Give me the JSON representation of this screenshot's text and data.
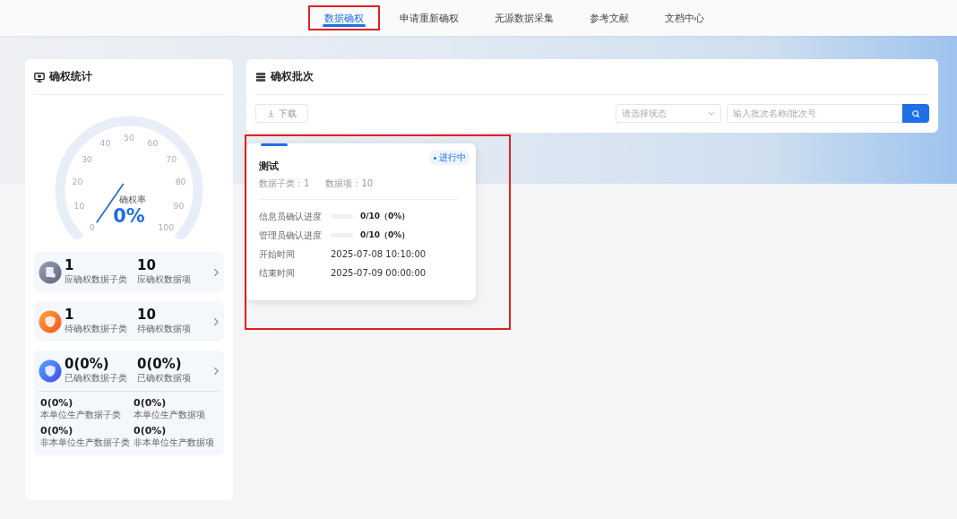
{
  "nav": {
    "tabs": [
      {
        "label": "数据确权",
        "selected": true,
        "highlight": true
      },
      {
        "label": "申请重新确权",
        "selected": false,
        "highlight": false
      },
      {
        "label": "无源数据采集",
        "selected": false,
        "highlight": false
      },
      {
        "label": "参考文献",
        "selected": false,
        "highlight": false
      },
      {
        "label": "文档中心",
        "selected": false,
        "highlight": false
      }
    ]
  },
  "stats": {
    "title": "确权统计",
    "gauge": {
      "ticks": [
        "0",
        "10",
        "20",
        "30",
        "40",
        "50",
        "60",
        "70",
        "80",
        "90",
        "100"
      ],
      "label": "确权率",
      "value": "0%"
    },
    "groups": [
      {
        "kind": "total",
        "a_value": "1",
        "a_label": "应确权数据子类",
        "b_value": "10",
        "b_label": "应确权数据项"
      },
      {
        "kind": "pending",
        "a_value": "1",
        "a_label": "待确权数据子类",
        "b_value": "10",
        "b_label": "待确权数据项"
      },
      {
        "kind": "done",
        "a_value": "0(0%)",
        "a_label": "已确权数据子类",
        "b_value": "0(0%)",
        "b_label": "已确权数据项",
        "details": [
          {
            "value": "0(0%)",
            "label": "本单位生产数据子类"
          },
          {
            "value": "0(0%)",
            "label": "本单位生产数据项"
          },
          {
            "value": "0(0%)",
            "label": "非本单位生产数据子类"
          },
          {
            "value": "0(0%)",
            "label": "非本单位生产数据项"
          }
        ]
      }
    ]
  },
  "batches": {
    "title": "确权批次",
    "download": "下载",
    "status_placeholder": "请选择状态",
    "search_placeholder": "输入批次名称/批次号",
    "cards": [
      {
        "name": "测试",
        "status": "进行中",
        "highlight": true,
        "subclass": "数据子类：1",
        "items": "数据项：10",
        "progress": [
          {
            "label": "信息员确认进度",
            "level": 0,
            "text": "0/10（0%）"
          },
          {
            "label": "管理员确认进度",
            "level": 0,
            "text": "0/10（0%）"
          }
        ],
        "times": [
          {
            "label": "开始时间",
            "value": "2025-07-08 10:10:00"
          },
          {
            "label": "结束时间",
            "value": "2025-07-09 00:00:00"
          }
        ]
      }
    ]
  }
}
